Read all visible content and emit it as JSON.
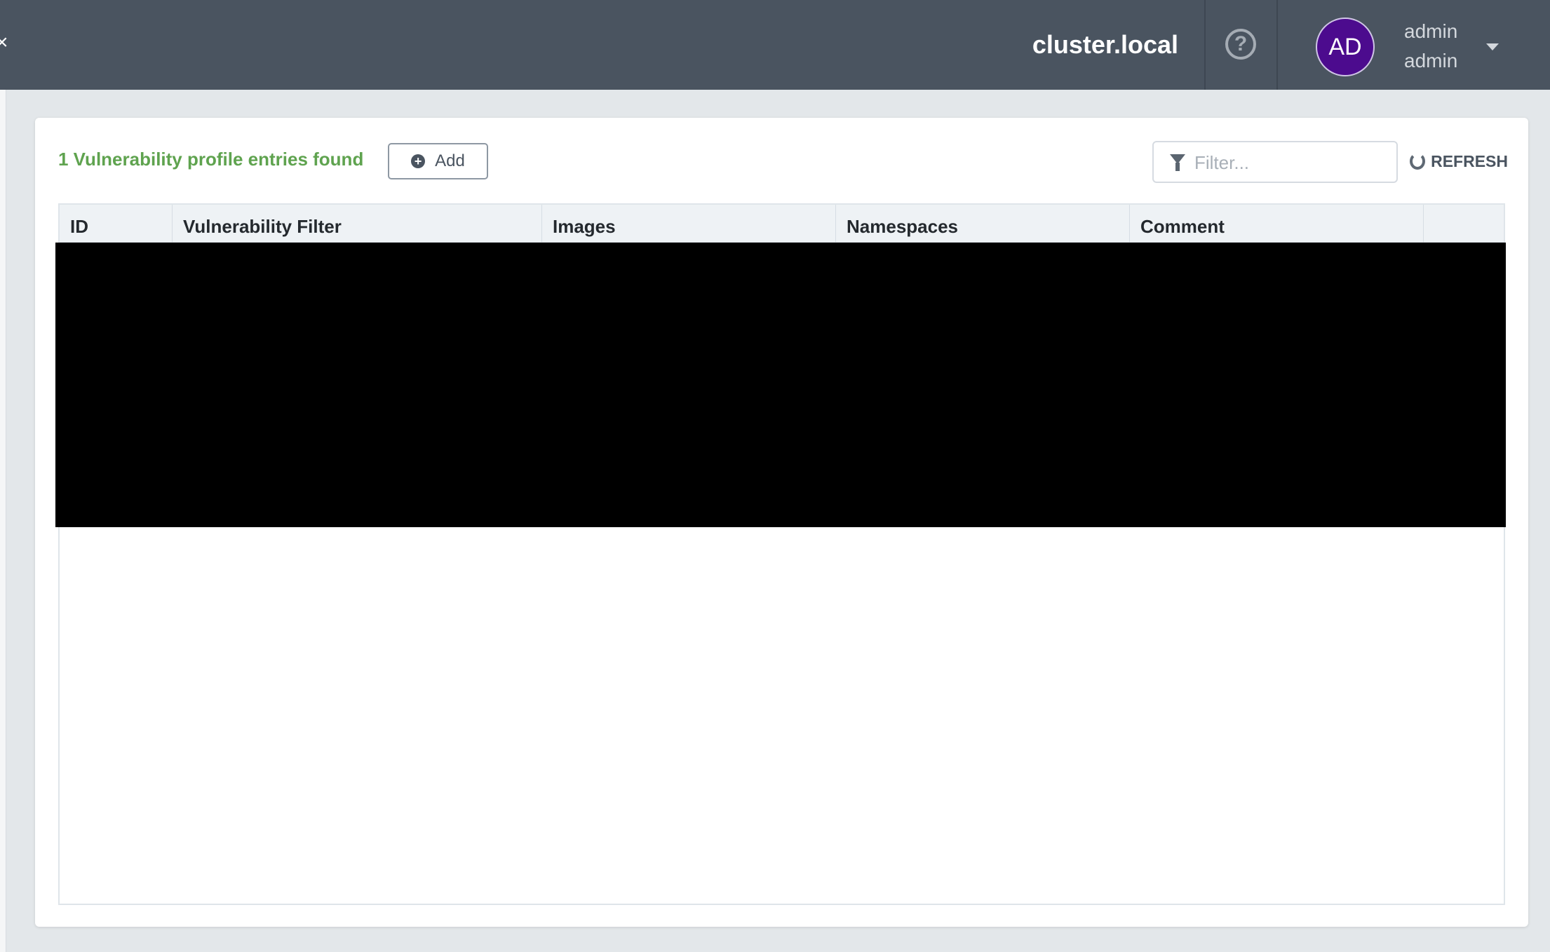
{
  "header": {
    "cluster": "cluster.local",
    "user": {
      "avatar_initials": "AD",
      "line1": "admin",
      "line2": "admin"
    }
  },
  "toolbar": {
    "entry_count": "1 Vulnerability profile entries found",
    "add_label": "Add",
    "filter_placeholder": "Filter...",
    "refresh_label": "REFRESH"
  },
  "table": {
    "columns": [
      "ID",
      "Vulnerability Filter",
      "Images",
      "Namespaces",
      "Comment",
      ""
    ]
  }
}
